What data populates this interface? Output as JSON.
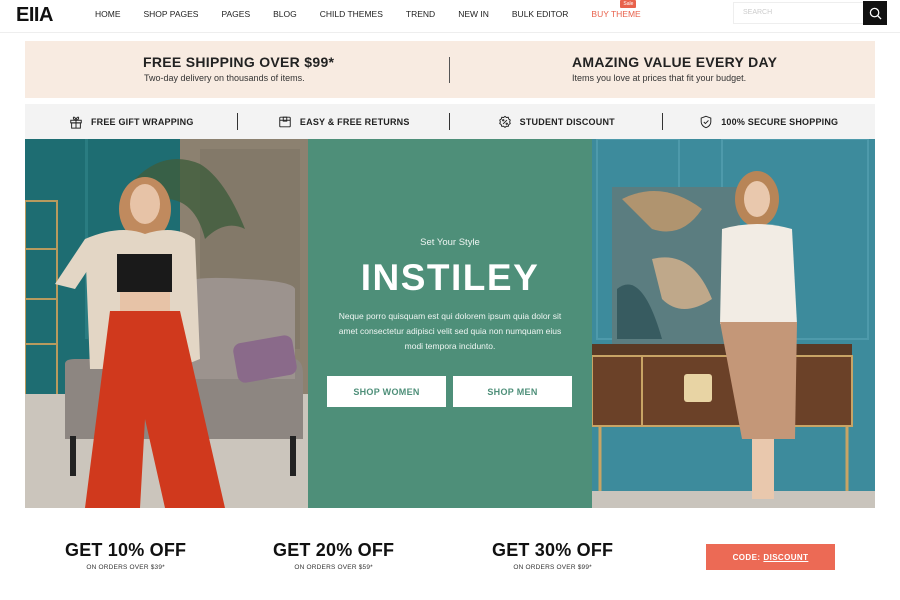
{
  "header": {
    "logo": "EIIA",
    "nav": [
      {
        "label": "HOME"
      },
      {
        "label": "SHOP PAGES"
      },
      {
        "label": "PAGES"
      },
      {
        "label": "BLOG"
      },
      {
        "label": "CHILD THEMES"
      },
      {
        "label": "TREND"
      },
      {
        "label": "NEW IN"
      },
      {
        "label": "BULK EDITOR"
      },
      {
        "label": "BUY THEME",
        "badge": "Sale"
      }
    ],
    "search_placeholder": "SEARCH",
    "search_icon": "search-icon"
  },
  "promo": {
    "left": {
      "title": "FREE SHIPPING OVER $99*",
      "subtitle": "Two-day delivery on thousands of items."
    },
    "right": {
      "title": "AMAZING VALUE EVERY DAY",
      "subtitle": "Items you love at prices that fit your budget."
    }
  },
  "features": [
    {
      "icon": "gift-icon",
      "label": "FREE GIFT WRAPPING"
    },
    {
      "icon": "box-icon",
      "label": "EASY & FREE RETURNS"
    },
    {
      "icon": "percent-badge-icon",
      "label": "STUDENT DISCOUNT"
    },
    {
      "icon": "shield-check-icon",
      "label": "100% SECURE SHOPPING"
    }
  ],
  "hero": {
    "kicker": "Set Your Style",
    "title": "INSTILEY",
    "description": "Neque porro quisquam est qui dolorem ipsum quia dolor sit amet consectetur adipisci velit sed quia non numquam eius modi tempora incidunto.",
    "buttons": [
      {
        "label": "SHOP WOMEN"
      },
      {
        "label": "SHOP MEN"
      }
    ],
    "left_image": "woman in beige shirt, black crop top and red wide-leg pants by grey sofa",
    "right_image": "woman in white sleeveless top and tan skirt leaning on desk"
  },
  "offers": [
    {
      "title": "GET 10% OFF",
      "subtitle": "ON ORDERS OVER $39*",
      "highlight": "#f7dfe3"
    },
    {
      "title": "GET 20% OFF",
      "subtitle": "ON ORDERS OVER $59*",
      "highlight": "#f8ebd9"
    },
    {
      "title": "GET 30% OFF",
      "subtitle": "ON ORDERS OVER $99*",
      "highlight": "#f5c1b0"
    }
  ],
  "code_button": {
    "prefix": "CODE:",
    "code": "DISCOUNT"
  },
  "colors": {
    "accent": "#ec6a55",
    "hero_green": "#4e8f79",
    "promo_bg": "#f8ebe1",
    "feature_bg": "#f3f3f3"
  }
}
